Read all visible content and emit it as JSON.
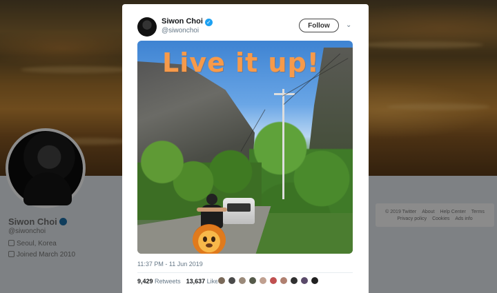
{
  "background": {
    "profile": {
      "name": "Siwon Choi",
      "handle": "@siwonchoi",
      "location": "Seoul, Korea",
      "joined": "Joined March 2010"
    },
    "footer_links": [
      "© 2019 Twitter",
      "About",
      "Help Center",
      "Terms",
      "Privacy policy",
      "Cookies",
      "Ads info"
    ]
  },
  "tweet": {
    "author": {
      "name": "Siwon Choi",
      "handle": "@siwonchoi",
      "verified": true
    },
    "follow_label": "Follow",
    "media_overlay_text": "Live it up!",
    "timestamp": "11:37 PM - 11 Jun 2019",
    "retweets_count": "9,429",
    "retweets_label": "Retweets",
    "likes_count": "13,637",
    "likes_label": "Likes",
    "liker_colors": [
      "#7a6a5a",
      "#4a4a4a",
      "#9a8a7a",
      "#555a4a",
      "#c0a090",
      "#c05050",
      "#b08070",
      "#303030",
      "#5a4a6a",
      "#202020"
    ]
  },
  "colors": {
    "verified": "#1da1f2",
    "overlay_text": "#f79a4a"
  }
}
